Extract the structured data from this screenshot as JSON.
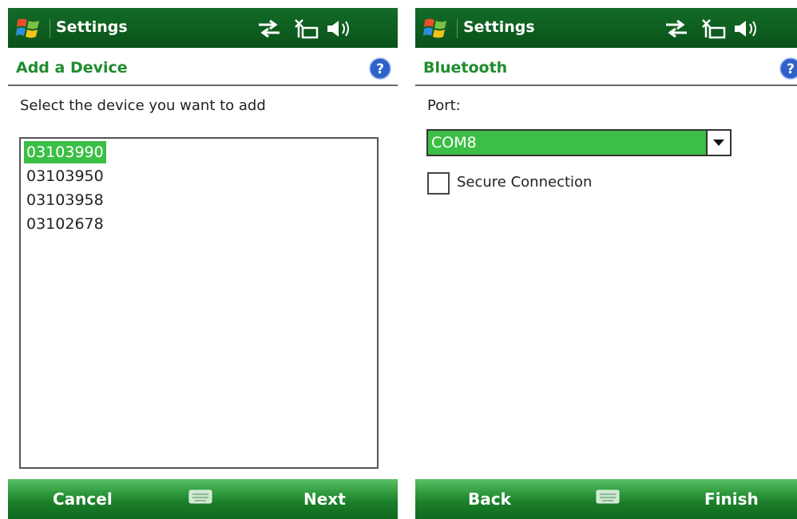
{
  "left": {
    "status_title": "Settings",
    "page_title": "Add a Device",
    "instruction": "Select the device you want to add",
    "devices": [
      "03103990",
      "03103950",
      "03103958",
      "03102678"
    ],
    "selected_index": 0,
    "softkey_left": "Cancel",
    "softkey_right": "Next"
  },
  "right": {
    "status_title": "Settings",
    "page_title": "Bluetooth",
    "port_label": "Port:",
    "port_value": "COM8",
    "secure_label": "Secure Connection",
    "secure_checked": false,
    "softkey_left": "Back",
    "softkey_right": "Finish"
  },
  "status_icons": [
    "connectivity-arrows-icon",
    "no-signal-antenna-icon",
    "speaker-volume-icon"
  ],
  "colors": {
    "status_bar": "#0b5a1e",
    "title_green": "#1f8c2d",
    "selection_green": "#3cbf46",
    "help_blue": "#2f62c9"
  }
}
